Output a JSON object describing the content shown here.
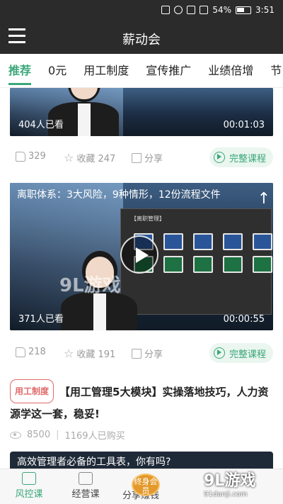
{
  "status_bar": {
    "battery": "54%",
    "time": "3:51"
  },
  "header": {
    "title": "薪动会"
  },
  "tabs": [
    {
      "label": "推荐",
      "active": true
    },
    {
      "label": "0元"
    },
    {
      "label": "用工制度"
    },
    {
      "label": "宣传推广"
    },
    {
      "label": "业绩倍增"
    },
    {
      "label": "节"
    }
  ],
  "videos": [
    {
      "views": "404人已看",
      "duration": "00:01:03",
      "likes": "329",
      "favorites": "收藏 247",
      "share": "分享",
      "full_course": "完整课程"
    },
    {
      "title": "离职体系：3大风险，9种情形，12份流程文件",
      "screen_heading": "【离职管理】",
      "views": "371人已看",
      "duration": "00:00:55",
      "likes": "218",
      "favorites": "收藏 191",
      "share": "分享",
      "full_course": "完整课程"
    }
  ],
  "article": {
    "tag": "用工制度",
    "title": "【用工管理5大模块】实操落地技巧，人力资源学这一套，稳妥!",
    "views": "8500",
    "purchased": "1169人已购买"
  },
  "promo": {
    "text": "高效管理者必备的工具表，你有吗?",
    "badge": "终身会员"
  },
  "bottom_nav": [
    {
      "label": "风控课",
      "active": true
    },
    {
      "label": "经营课"
    },
    {
      "label": "分享赚钱"
    }
  ],
  "watermark": {
    "main": "9L游戏",
    "sub": "91danji.com",
    "overlay": "9L游戏"
  },
  "colors": {
    "accent": "#3aa779",
    "tag": "#e06a6a",
    "header": "#2b2b2b"
  }
}
